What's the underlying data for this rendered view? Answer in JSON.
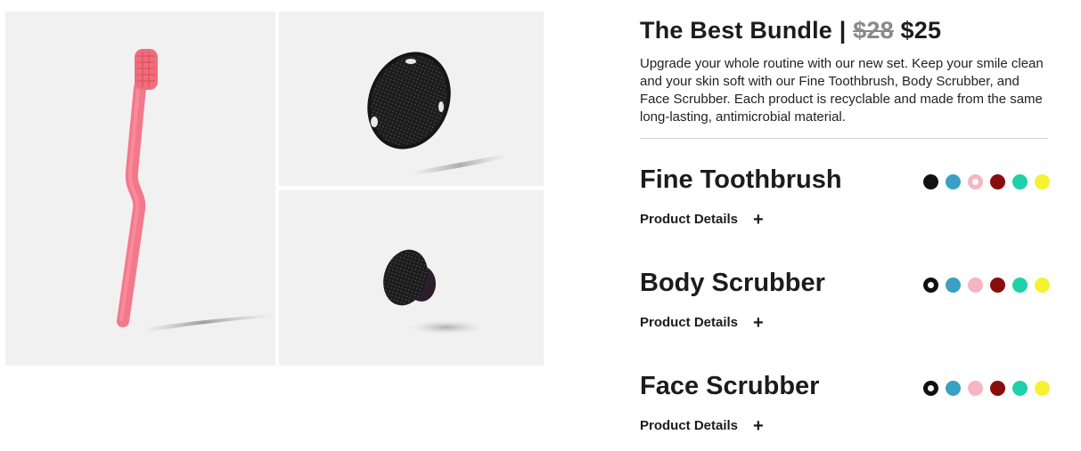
{
  "bundle": {
    "title": "The Best Bundle |",
    "old_price": "$28",
    "new_price": "$25",
    "description": "Upgrade your whole routine with our new set. Keep your smile clean and your skin soft with our Fine Toothbrush, Body Scrubber, and Face Scrubber. Each product is recyclable and made from the same long-lasting, antimicrobial material."
  },
  "gallery": {
    "images": [
      {
        "icon": "pink-toothbrush-image"
      },
      {
        "icon": "black-body-scrubber-image"
      },
      {
        "icon": "black-face-scrubber-image"
      }
    ]
  },
  "colors": {
    "black": "#111111",
    "blue": "#3aa0c4",
    "pink": "#f5b5c5",
    "red": "#8b0c0c",
    "teal": "#1fd1aa",
    "yellow": "#f6f230"
  },
  "products": [
    {
      "name": "Fine Toothbrush",
      "details_label": "Product Details",
      "details_icon": "+",
      "selected_color": "pink"
    },
    {
      "name": "Body Scrubber",
      "details_label": "Product Details",
      "details_icon": "+",
      "selected_color": "black"
    },
    {
      "name": "Face Scrubber",
      "details_label": "Product Details",
      "details_icon": "+",
      "selected_color": "black"
    }
  ]
}
